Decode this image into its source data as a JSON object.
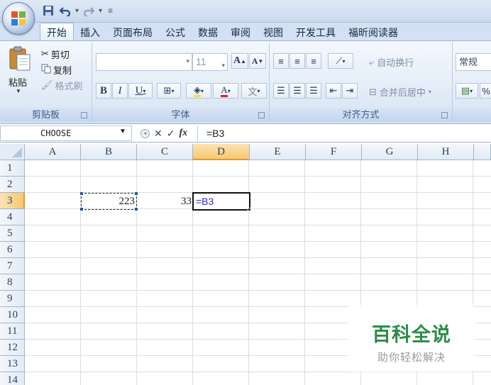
{
  "title_bar": {
    "quick_access": [
      {
        "name": "save-icon"
      },
      {
        "name": "undo-icon"
      },
      {
        "name": "redo-icon"
      },
      {
        "name": "customize-qat-icon"
      }
    ]
  },
  "tabs": [
    "开始",
    "插入",
    "页面布局",
    "公式",
    "数据",
    "审阅",
    "视图",
    "开发工具",
    "福昕阅读器"
  ],
  "active_tab": "开始",
  "ribbon": {
    "clipboard": {
      "label": "剪贴板",
      "paste": "粘贴",
      "cut": "剪切",
      "copy": "复制",
      "format_painter": "格式刷"
    },
    "font": {
      "label": "字体",
      "font_name": "",
      "font_size": "11",
      "bold": "B",
      "italic": "I",
      "underline": "U",
      "grow": "A",
      "shrink": "A"
    },
    "alignment": {
      "label": "对齐方式",
      "wrap_text": "自动换行",
      "merge_center": "合并后居中"
    },
    "number": {
      "format": "常规",
      "percent": "%"
    }
  },
  "formula_bar": {
    "name_box": "CHOOSE",
    "formula": "=B3"
  },
  "grid": {
    "columns": [
      "A",
      "B",
      "C",
      "D",
      "E",
      "F",
      "G",
      "H"
    ],
    "rows": [
      "1",
      "2",
      "3",
      "4",
      "5",
      "6",
      "7",
      "8",
      "9",
      "10",
      "11",
      "12",
      "13",
      "14"
    ],
    "selected_column": "D",
    "selected_row": "3",
    "cells": {
      "B3": "223",
      "C3": "33",
      "D3": "=B3"
    },
    "copy_range": "B3",
    "active_cell": "D3",
    "formula_ref_color": "#2a2ad6"
  },
  "watermark": {
    "title": "百科全说",
    "subtitle": "助你轻松解决"
  },
  "colors": {
    "ribbon_bg": "#e3ecf8",
    "selected_header": "#f7c872",
    "watermark_green": "#2a8c48"
  }
}
